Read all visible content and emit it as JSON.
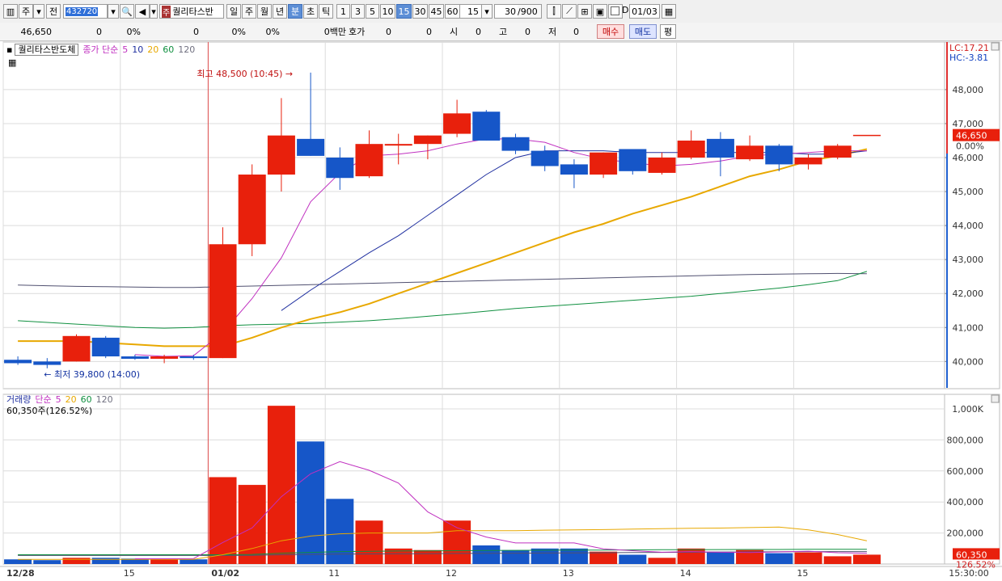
{
  "toolbar": {
    "type_label": "주",
    "prev_label": "전",
    "code": "432720",
    "stock_name": "퀄리타스반",
    "stock_prefix": "주",
    "periods": [
      "일",
      "주",
      "월",
      "년",
      "분",
      "초",
      "틱"
    ],
    "selected_period": "분",
    "intervals": [
      "1",
      "3",
      "5",
      "10",
      "15",
      "30",
      "45",
      "60"
    ],
    "selected_interval": "15",
    "interval_value": "15",
    "count": "30",
    "count_max": "/900",
    "d_label": "D",
    "date": "01/03"
  },
  "quote": {
    "price": "46,650",
    "change": "0",
    "change_pct": "0%",
    "volume": "0",
    "vol_pct": "0%",
    "pct3": "0%",
    "amount": "0백만",
    "hoga_label": "호가",
    "hoga_value": "0",
    "hoga_value2": "0",
    "open_label": "시",
    "open_value": "0",
    "high_label": "고",
    "high_value": "0",
    "low_label": "저",
    "low_value": "0",
    "buy_label": "매수",
    "sell_label": "매도",
    "avg_label": "평"
  },
  "price_legend": {
    "stock": "퀄리타스반도체",
    "series": "종가 단순",
    "ma5": "5",
    "ma10": "10",
    "ma20": "20",
    "ma60": "60",
    "ma120": "120"
  },
  "volume_legend": {
    "series": "거래량",
    "simple": "단순",
    "ma5": "5",
    "ma20": "20",
    "ma60": "60",
    "ma120": "120",
    "current": "60,350주(126.52%)"
  },
  "annotations": {
    "high": "최고 48,500 (10:45)",
    "low": "최저 39,800 (14:00)",
    "lc": "LC:17.21",
    "hc": "HC:-3.81",
    "price_tag": "46,650",
    "pct_tag": "0.00%",
    "vol_tag": "60,350",
    "vol_pct_tag": "126.52%"
  },
  "colors": {
    "up": "#e8200c",
    "down": "#1656c8",
    "ma5": "#c030c0",
    "ma10": "#2030a0",
    "ma20": "#e8a800",
    "ma60": "#109040",
    "ma120": "#404060",
    "grid": "#dcdcdc"
  },
  "chart_data": {
    "type": "candlestick",
    "y_range": [
      39200,
      49400
    ],
    "y_ticks": [
      "40,000",
      "41,000",
      "42,000",
      "43,000",
      "44,000",
      "45,000",
      "46,000",
      "47,000",
      "48,000"
    ],
    "y_tick_values": [
      40000,
      41000,
      42000,
      43000,
      44000,
      45000,
      46000,
      47000,
      48000
    ],
    "candles": [
      {
        "o": 40050,
        "h": 40150,
        "l": 39900,
        "c": 39950
      },
      {
        "o": 40000,
        "h": 40100,
        "l": 39800,
        "c": 39900
      },
      {
        "o": 40000,
        "h": 40800,
        "l": 40000,
        "c": 40750
      },
      {
        "o": 40700,
        "h": 40750,
        "l": 40100,
        "c": 40150
      },
      {
        "o": 40150,
        "h": 40200,
        "l": 40050,
        "c": 40080
      },
      {
        "o": 40080,
        "h": 40200,
        "l": 39950,
        "c": 40150
      },
      {
        "o": 40150,
        "h": 40200,
        "l": 40050,
        "c": 40100
      },
      {
        "o": 40100,
        "h": 43950,
        "l": 40100,
        "c": 43450
      },
      {
        "o": 43450,
        "h": 45800,
        "l": 43100,
        "c": 45500
      },
      {
        "o": 45500,
        "h": 47750,
        "l": 45000,
        "c": 46650
      },
      {
        "o": 46550,
        "h": 48500,
        "l": 46050,
        "c": 46050
      },
      {
        "o": 46000,
        "h": 46300,
        "l": 45050,
        "c": 45400
      },
      {
        "o": 45450,
        "h": 46800,
        "l": 45400,
        "c": 46400
      },
      {
        "o": 46400,
        "h": 46700,
        "l": 45800,
        "c": 46400
      },
      {
        "o": 46400,
        "h": 46650,
        "l": 45950,
        "c": 46650
      },
      {
        "o": 46700,
        "h": 47700,
        "l": 46600,
        "c": 47300
      },
      {
        "o": 47350,
        "h": 47400,
        "l": 46500,
        "c": 46500
      },
      {
        "o": 46600,
        "h": 46700,
        "l": 46100,
        "c": 46200
      },
      {
        "o": 46200,
        "h": 46350,
        "l": 45600,
        "c": 45750
      },
      {
        "o": 45800,
        "h": 45950,
        "l": 45100,
        "c": 45500
      },
      {
        "o": 45500,
        "h": 46150,
        "l": 45400,
        "c": 46150
      },
      {
        "o": 46250,
        "h": 46250,
        "l": 45500,
        "c": 45600
      },
      {
        "o": 45550,
        "h": 46150,
        "l": 45500,
        "c": 46000
      },
      {
        "o": 46000,
        "h": 46800,
        "l": 45950,
        "c": 46500
      },
      {
        "o": 46550,
        "h": 46750,
        "l": 45450,
        "c": 46000
      },
      {
        "o": 45950,
        "h": 46650,
        "l": 45900,
        "c": 46350
      },
      {
        "o": 46350,
        "h": 46400,
        "l": 45600,
        "c": 45800
      },
      {
        "o": 45800,
        "h": 46100,
        "l": 45650,
        "c": 46000
      },
      {
        "o": 46000,
        "h": 46400,
        "l": 45950,
        "c": 46350
      },
      {
        "o": 46650,
        "h": 46650,
        "l": 46650,
        "c": 46650
      }
    ],
    "ma5": [
      null,
      null,
      null,
      null,
      40200,
      40150,
      40170,
      40850,
      41850,
      43050,
      44700,
      45550,
      46050,
      46100,
      46200,
      46400,
      46550,
      46550,
      46450,
      46150,
      45950,
      45850,
      45750,
      45800,
      45900,
      46050,
      46100,
      46150,
      46200,
      46200
    ],
    "ma10": [
      null,
      null,
      null,
      null,
      null,
      null,
      null,
      null,
      null,
      41500,
      42100,
      42650,
      43200,
      43700,
      44300,
      44900,
      45500,
      46000,
      46200,
      46200,
      46200,
      46150,
      46150,
      46150,
      46150,
      46150,
      46150,
      46100,
      46100,
      46200
    ],
    "ma20": [
      40600,
      40600,
      40600,
      40550,
      40500,
      40450,
      40450,
      40450,
      40700,
      41000,
      41250,
      41450,
      41700,
      42000,
      42300,
      42600,
      42900,
      43200,
      43500,
      43800,
      44050,
      44350,
      44600,
      44850,
      45150,
      45450,
      45650,
      45900,
      46050,
      46250
    ],
    "ma60": [
      41200,
      41150,
      41100,
      41050,
      41000,
      40980,
      41000,
      41050,
      41080,
      41100,
      41120,
      41160,
      41200,
      41260,
      41330,
      41400,
      41480,
      41560,
      41620,
      41680,
      41740,
      41800,
      41860,
      41920,
      42000,
      42080,
      42160,
      42260,
      42380,
      42650
    ],
    "ma120": [
      42250,
      42230,
      42210,
      42200,
      42190,
      42180,
      42180,
      42200,
      42220,
      42240,
      42260,
      42280,
      42300,
      42320,
      42340,
      42360,
      42380,
      42400,
      42420,
      42440,
      42460,
      42480,
      42500,
      42520,
      42540,
      42560,
      42570,
      42580,
      42590,
      42580
    ],
    "x_labels": [
      "12/28",
      "15",
      "01/02",
      "11",
      "12",
      "13",
      "14",
      "15",
      "15:30:00"
    ],
    "x_label_index": [
      0,
      4,
      7,
      11,
      15,
      19,
      23,
      27,
      29
    ],
    "volume": {
      "y_range": [
        0,
        1000000
      ],
      "y_ticks": [
        "200,000",
        "400,000",
        "600,000",
        "800,000",
        "1,000K"
      ],
      "y_tick_values": [
        200000,
        400000,
        600000,
        800000,
        1000000
      ],
      "values": [
        30000,
        25000,
        40000,
        40000,
        35000,
        30000,
        30000,
        560000,
        510000,
        1020000,
        790000,
        420000,
        280000,
        100000,
        90000,
        280000,
        120000,
        90000,
        100000,
        100000,
        80000,
        60000,
        40000,
        100000,
        80000,
        90000,
        70000,
        75000,
        50000,
        60350
      ],
      "ma5": [
        null,
        null,
        null,
        null,
        34000,
        34000,
        35000,
        139000,
        233000,
        434000,
        582000,
        660000,
        604000,
        522000,
        336000,
        234000,
        174000,
        136000,
        136000,
        136000,
        98000,
        86000,
        76000,
        80000,
        76000,
        74000,
        78000,
        83000,
        73000,
        70000
      ],
      "ma20": [
        30000,
        30000,
        30000,
        30000,
        30000,
        30000,
        30000,
        60000,
        100000,
        150000,
        180000,
        195000,
        200000,
        200000,
        200000,
        215000,
        215000,
        215000,
        218000,
        220000,
        222000,
        225000,
        228000,
        230000,
        232000,
        235000,
        238000,
        220000,
        190000,
        150000
      ],
      "ma60": [
        60000,
        60000,
        60000,
        60000,
        60000,
        60000,
        60000,
        60000,
        62000,
        70000,
        75000,
        80000,
        82000,
        84000,
        85000,
        86000,
        87000,
        88000,
        89000,
        90000,
        90000,
        91000,
        92000,
        92000,
        93000,
        94000,
        94000,
        95000,
        95000,
        95000
      ],
      "ma120": [
        55000,
        55000,
        55000,
        55000,
        55000,
        55000,
        55000,
        55000,
        56000,
        60000,
        62000,
        64000,
        65000,
        66000,
        67000,
        68000,
        69000,
        70000,
        71000,
        72000,
        73000,
        74000,
        75000,
        76000,
        77000,
        78000,
        79000,
        80000,
        80000,
        80000
      ]
    }
  }
}
